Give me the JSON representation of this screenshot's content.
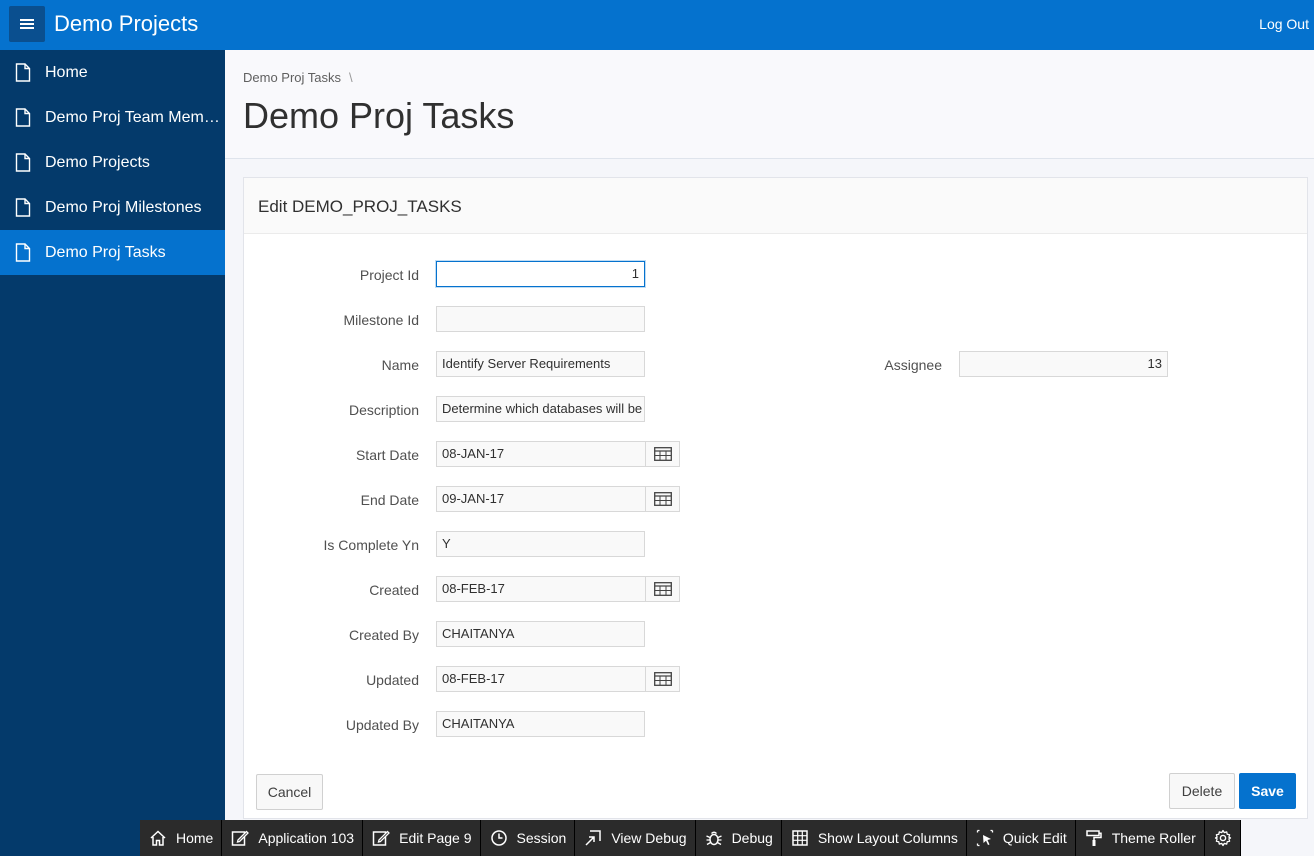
{
  "header": {
    "app_title": "Demo Projects",
    "logout_label": "Log Out",
    "menu_icon": "hamburger-menu-icon"
  },
  "sidebar": {
    "items": [
      {
        "label": "Home",
        "icon": "document-icon",
        "active": false
      },
      {
        "label": "Demo Proj Team Members",
        "icon": "document-icon",
        "active": false
      },
      {
        "label": "Demo Projects",
        "icon": "document-icon",
        "active": false
      },
      {
        "label": "Demo Proj Milestones",
        "icon": "document-icon",
        "active": false
      },
      {
        "label": "Demo Proj Tasks",
        "icon": "document-icon",
        "active": true
      }
    ]
  },
  "breadcrumb": {
    "item": "Demo Proj Tasks",
    "separator": "\\"
  },
  "page": {
    "title": "Demo Proj Tasks"
  },
  "region": {
    "title": "Edit DEMO_PROJ_TASKS"
  },
  "form": {
    "project_id": {
      "label": "Project Id",
      "value": "1"
    },
    "milestone_id": {
      "label": "Milestone Id",
      "value": ""
    },
    "name": {
      "label": "Name",
      "value": "Identify Server Requirements"
    },
    "assignee": {
      "label": "Assignee",
      "value": "13"
    },
    "description": {
      "label": "Description",
      "value": "Determine which databases will be"
    },
    "start_date": {
      "label": "Start Date",
      "value": "08-JAN-17"
    },
    "end_date": {
      "label": "End Date",
      "value": "09-JAN-17"
    },
    "is_complete_yn": {
      "label": "Is Complete Yn",
      "value": "Y"
    },
    "created": {
      "label": "Created",
      "value": "08-FEB-17"
    },
    "created_by": {
      "label": "Created By",
      "value": "CHAITANYA"
    },
    "updated": {
      "label": "Updated",
      "value": "08-FEB-17"
    },
    "updated_by": {
      "label": "Updated By",
      "value": "CHAITANYA"
    }
  },
  "buttons": {
    "cancel": "Cancel",
    "delete": "Delete",
    "save": "Save"
  },
  "dev_toolbar": {
    "home": "Home",
    "application": "Application 103",
    "edit_page": "Edit Page 9",
    "session": "Session",
    "view_debug": "View Debug",
    "debug": "Debug",
    "show_layout_columns": "Show Layout Columns",
    "quick_edit": "Quick Edit",
    "theme_roller": "Theme Roller"
  },
  "colors": {
    "brand": "#0572ce",
    "sidebar": "#043a6b",
    "toolbar": "#2b2b2b"
  }
}
